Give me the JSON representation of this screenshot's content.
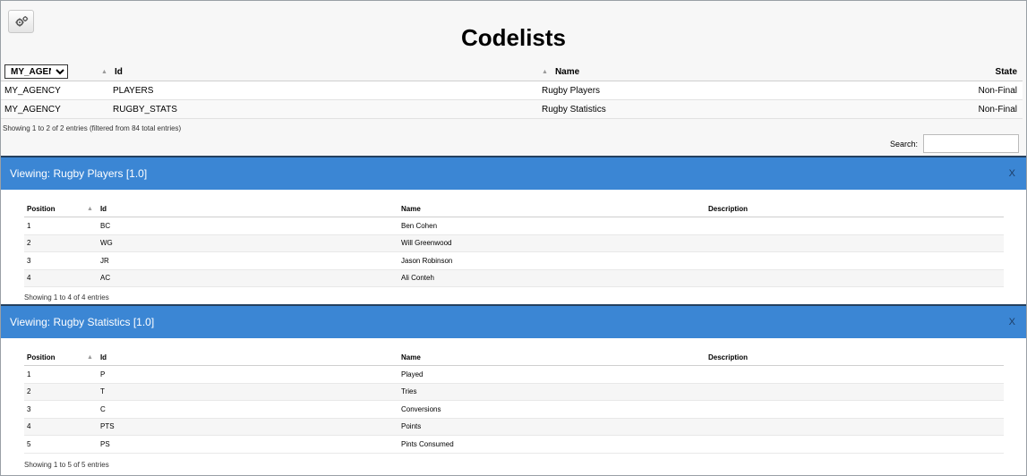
{
  "toolbar": {
    "settings_icon": "gears-icon"
  },
  "page": {
    "title": "Codelists"
  },
  "codelists": {
    "agency_selected": "MY_AGENCY",
    "headers": {
      "id": "Id",
      "name": "Name",
      "state": "State"
    },
    "rows": [
      {
        "agency": "MY_AGENCY",
        "id": "PLAYERS",
        "name": "Rugby Players",
        "state": "Non-Final"
      },
      {
        "agency": "MY_AGENCY",
        "id": "RUGBY_STATS",
        "name": "Rugby Statistics",
        "state": "Non-Final"
      }
    ],
    "info": "Showing 1 to 2 of 2 entries (filtered from 84 total entries)",
    "search_label": "Search:",
    "search_value": ""
  },
  "panels": [
    {
      "title": "Viewing: Rugby Players [1.0]",
      "close_label": "X",
      "headers": {
        "position": "Position",
        "id": "Id",
        "name": "Name",
        "description": "Description"
      },
      "rows": [
        {
          "position": "1",
          "id": "BC",
          "name": "Ben Cohen",
          "description": ""
        },
        {
          "position": "2",
          "id": "WG",
          "name": "Will Greenwood",
          "description": ""
        },
        {
          "position": "3",
          "id": "JR",
          "name": "Jason Robinson",
          "description": ""
        },
        {
          "position": "4",
          "id": "AC",
          "name": "Ali Conteh",
          "description": ""
        }
      ],
      "info": "Showing 1 to 4 of 4 entries"
    },
    {
      "title": "Viewing: Rugby Statistics [1.0]",
      "close_label": "X",
      "headers": {
        "position": "Position",
        "id": "Id",
        "name": "Name",
        "description": "Description"
      },
      "rows": [
        {
          "position": "1",
          "id": "P",
          "name": "Played",
          "description": ""
        },
        {
          "position": "2",
          "id": "T",
          "name": "Tries",
          "description": ""
        },
        {
          "position": "3",
          "id": "C",
          "name": "Conversions",
          "description": ""
        },
        {
          "position": "4",
          "id": "PTS",
          "name": "Points",
          "description": ""
        },
        {
          "position": "5",
          "id": "PS",
          "name": "Pints Consumed",
          "description": ""
        }
      ],
      "info": "Showing 1 to 5 of 5 entries"
    }
  ],
  "colors": {
    "panel_header": "#3b86d4",
    "panel_border": "#24405f"
  }
}
